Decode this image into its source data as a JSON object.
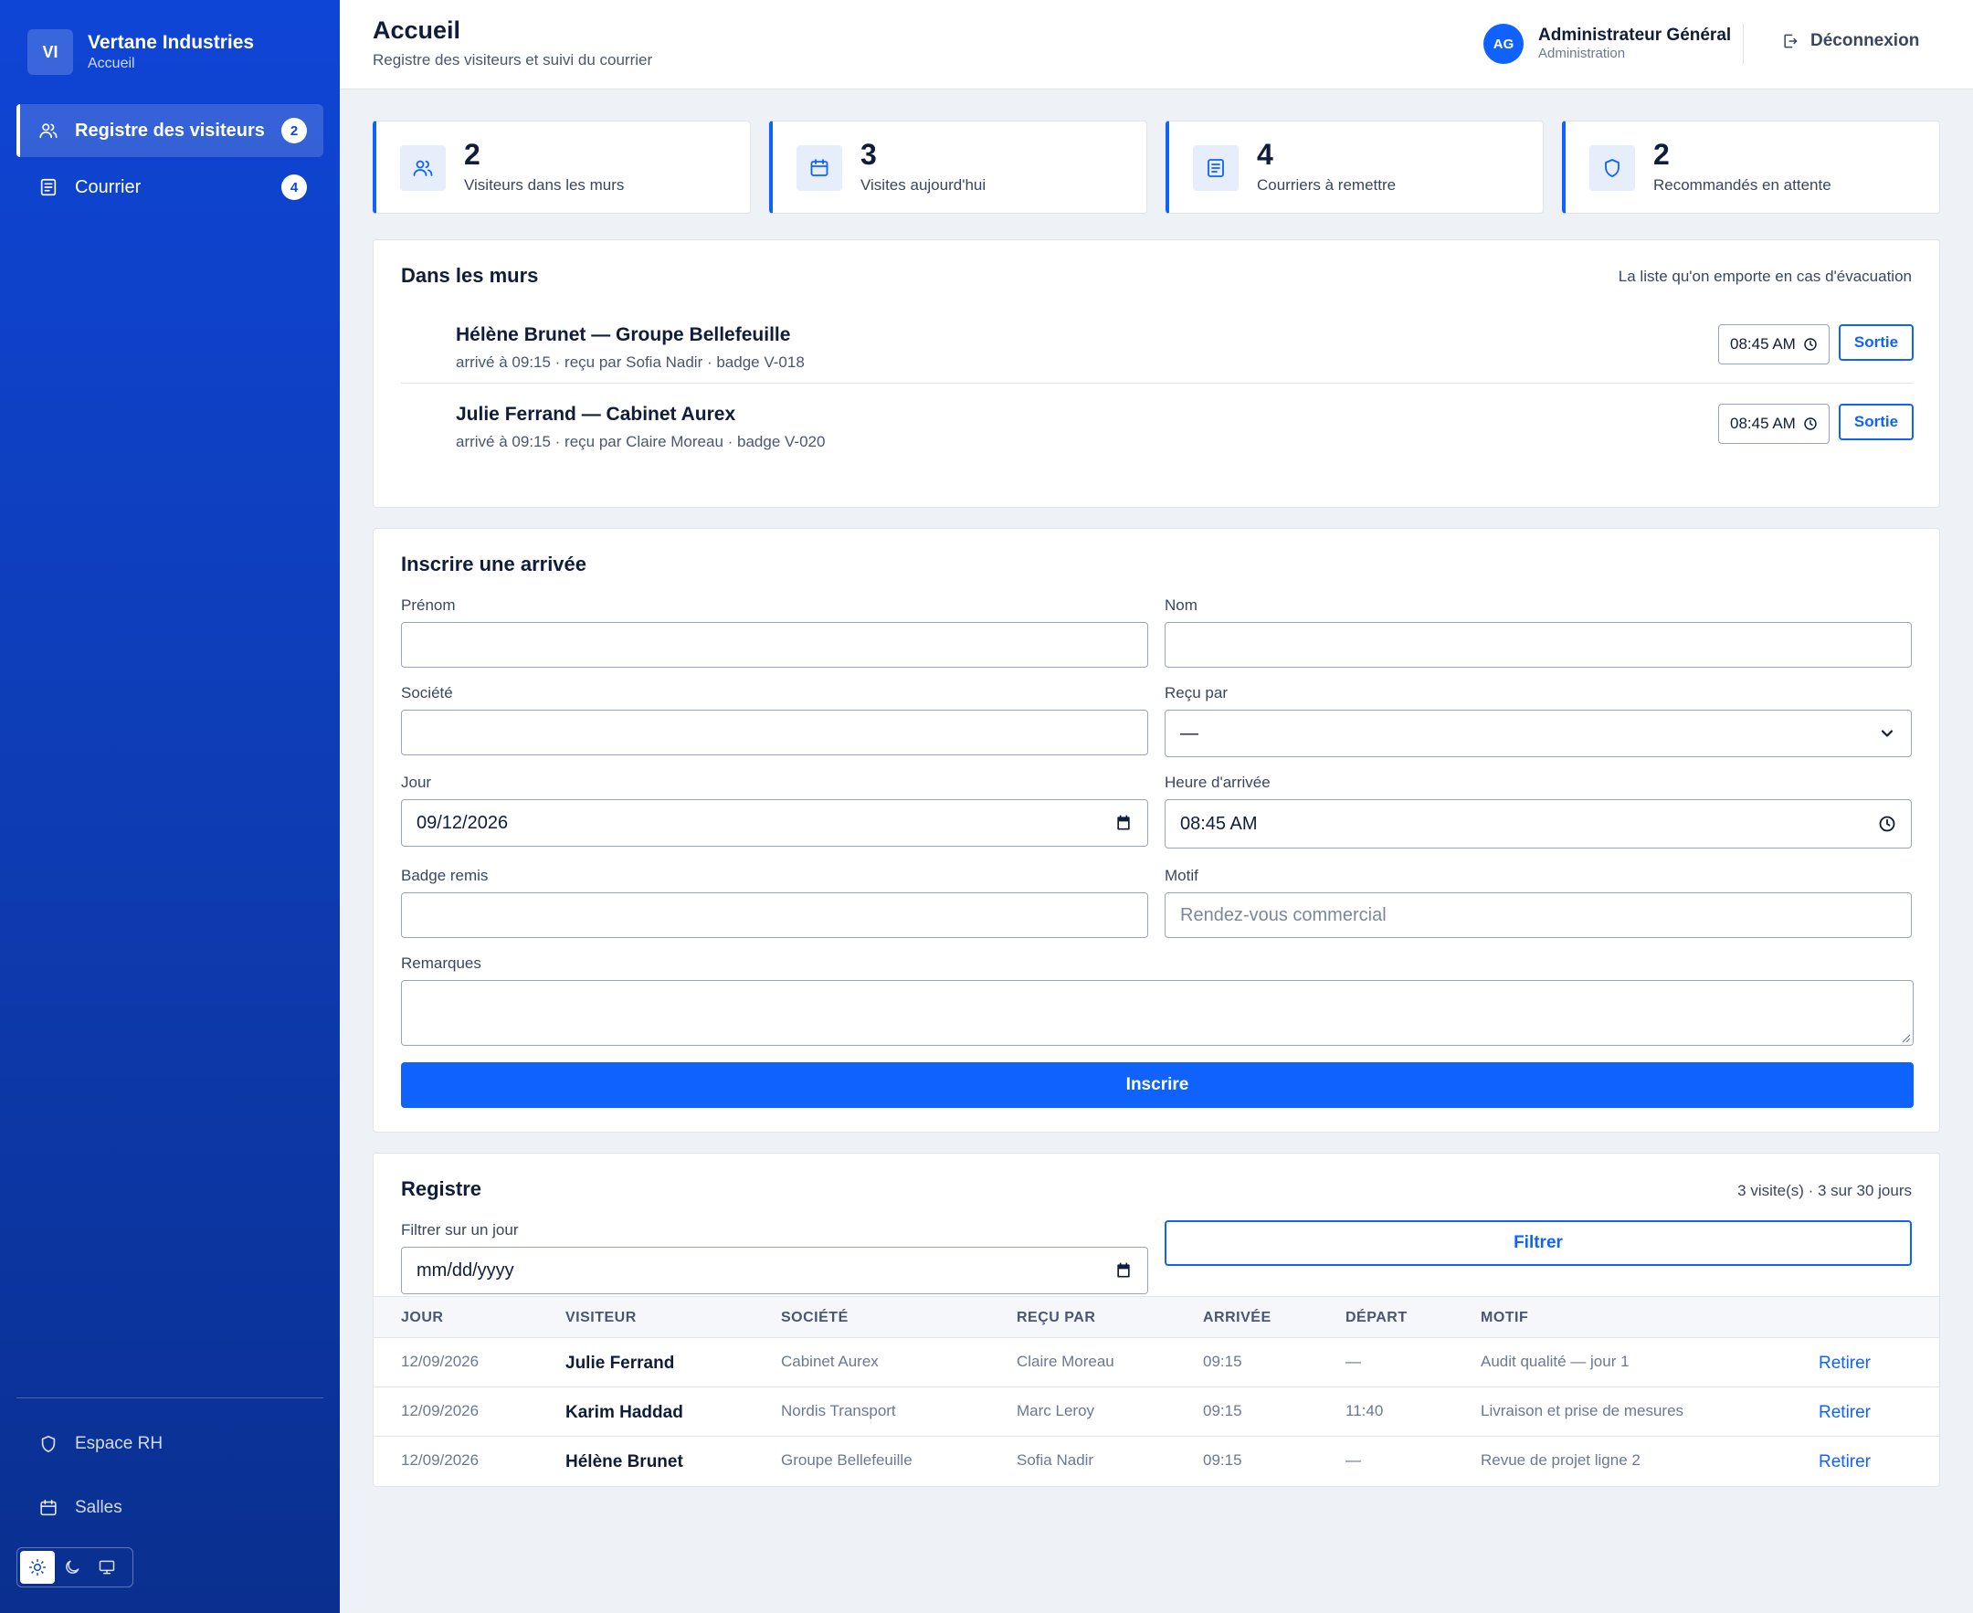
{
  "sidebar": {
    "logo_initials": "VI",
    "brand_name": "Vertane Industries",
    "brand_sub": "Accueil",
    "nav": [
      {
        "label": "Registre des visiteurs",
        "badge": "2",
        "icon": "users-icon",
        "active": true
      },
      {
        "label": "Courrier",
        "badge": "4",
        "icon": "document-icon",
        "active": false
      }
    ],
    "bottom": [
      {
        "label": "Espace RH",
        "icon": "shield-icon"
      },
      {
        "label": "Salles",
        "icon": "calendar-icon"
      }
    ],
    "theme_options": [
      "sun-icon",
      "moon-icon",
      "monitor-icon"
    ]
  },
  "header": {
    "title": "Accueil",
    "subtitle": "Registre des visiteurs et suivi du courrier",
    "user_initials": "AG",
    "user_name": "Administrateur Général",
    "user_role": "Administration",
    "logout_label": "Déconnexion"
  },
  "stats": [
    {
      "value": "2",
      "label": "Visiteurs dans les murs",
      "icon": "users-icon"
    },
    {
      "value": "3",
      "label": "Visites aujourd'hui",
      "icon": "calendar-icon"
    },
    {
      "value": "4",
      "label": "Courriers à remettre",
      "icon": "document-icon"
    },
    {
      "value": "2",
      "label": "Recommandés en attente",
      "icon": "shield-icon"
    }
  ],
  "inside": {
    "title": "Dans les murs",
    "note": "La liste qu'on emporte en cas d'évacuation",
    "visitors": [
      {
        "name": "Hélène Brunet — Groupe Bellefeuille",
        "meta": "arrivé à 09:15 · reçu par Sofia Nadir · badge V-018",
        "time": "08:45 AM",
        "action": "Sortie"
      },
      {
        "name": "Julie Ferrand — Cabinet Aurex",
        "meta": "arrivé à 09:15 · reçu par Claire Moreau · badge V-020",
        "time": "08:45 AM",
        "action": "Sortie"
      }
    ]
  },
  "form": {
    "title": "Inscrire une arrivée",
    "prenom_label": "Prénom",
    "prenom_value": "",
    "nom_label": "Nom",
    "nom_value": "",
    "societe_label": "Société",
    "societe_value": "",
    "recu_label": "Reçu par",
    "recu_value": "—",
    "jour_label": "Jour",
    "jour_value": "09/12/2026",
    "heure_label": "Heure d'arrivée",
    "heure_value": "08:45 AM",
    "badge_label": "Badge remis",
    "badge_value": "",
    "motif_label": "Motif",
    "motif_placeholder": "Rendez-vous commercial",
    "remarques_label": "Remarques",
    "submit_label": "Inscrire"
  },
  "registre": {
    "title": "Registre",
    "summary": "3 visite(s) · 3 sur 30 jours",
    "filter_label": "Filtrer sur un jour",
    "filter_placeholder": "mm/dd/yyyy",
    "filter_button": "Filtrer",
    "columns": [
      "JOUR",
      "VISITEUR",
      "SOCIÉTÉ",
      "REÇU PAR",
      "ARRIVÉE",
      "DÉPART",
      "MOTIF"
    ],
    "rows": [
      {
        "jour": "12/09/2026",
        "visiteur": "Julie Ferrand",
        "societe": "Cabinet Aurex",
        "recu": "Claire Moreau",
        "arrivee": "09:15",
        "depart": "—",
        "motif": "Audit qualité — jour 1",
        "action": "Retirer"
      },
      {
        "jour": "12/09/2026",
        "visiteur": "Karim Haddad",
        "societe": "Nordis Transport",
        "recu": "Marc Leroy",
        "arrivee": "09:15",
        "depart": "11:40",
        "motif": "Livraison et prise de mesures",
        "action": "Retirer"
      },
      {
        "jour": "12/09/2026",
        "visiteur": "Hélène Brunet",
        "societe": "Groupe Bellefeuille",
        "recu": "Sofia Nadir",
        "arrivee": "09:15",
        "depart": "—",
        "motif": "Revue de projet ligne 2",
        "action": "Retirer"
      }
    ]
  },
  "colors": {
    "accent": "#0f62fe",
    "sidebar": "#0f45d6",
    "background": "#eef2f6"
  }
}
